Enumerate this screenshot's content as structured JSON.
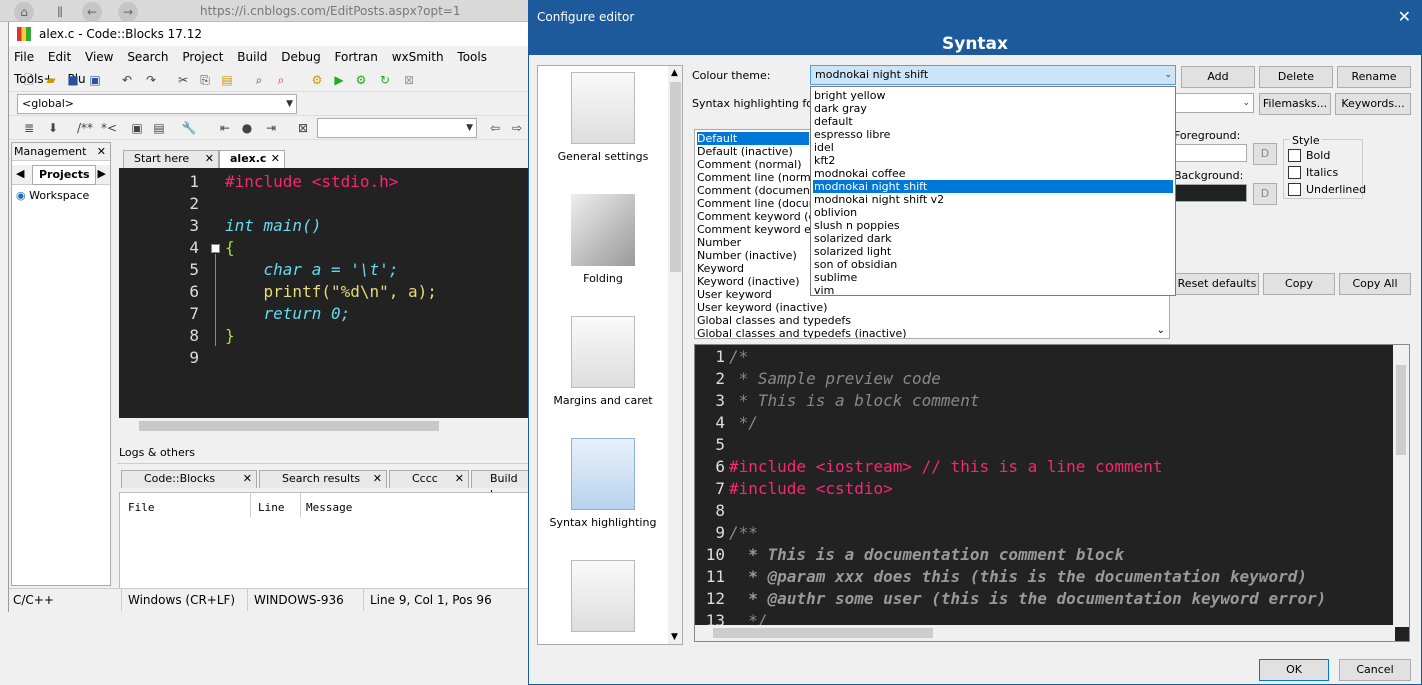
{
  "browser": {
    "url": "https://i.cnblogs.com/EditPosts.aspx?opt=1"
  },
  "cb": {
    "title": "alex.c - Code::Blocks 17.12",
    "menu": [
      "File",
      "Edit",
      "View",
      "Search",
      "Project",
      "Build",
      "Debug",
      "Fortran",
      "wxSmith",
      "Tools",
      "Tools+",
      "Plu"
    ],
    "scope": "<global>",
    "comment_btn": "/**",
    "comment_btn2": "*<",
    "management": "Management",
    "projects_tab": "Projects",
    "workspace": "Workspace",
    "tabs": [
      "Start here",
      "alex.c"
    ],
    "lines": [
      "1",
      "2",
      "3",
      "4",
      "5",
      "6",
      "7",
      "8",
      "9"
    ],
    "code": [
      "#include <stdio.h>",
      "",
      "int main()",
      "{",
      "    char a = '\\t';",
      "    printf(\"%d\\n\", a);",
      "    return 0;",
      "}",
      ""
    ],
    "logs_title": "Logs & others",
    "log_tabs": [
      "Code::Blocks",
      "Search results",
      "Cccc",
      "Build lo"
    ],
    "log_cols": [
      "File",
      "Line",
      "Message"
    ],
    "status": [
      "C/C++",
      "Windows (CR+LF)",
      "WINDOWS-936",
      "Line 9, Col 1, Pos 96"
    ]
  },
  "dialog": {
    "title": "Configure editor",
    "heading": "Syntax",
    "categories": [
      "General settings",
      "Folding",
      "Margins and caret",
      "Syntax highlighting"
    ],
    "colour_theme_label": "Colour theme:",
    "colour_theme_value": "modnokai night shift",
    "syntax_for_label": "Syntax highlighting for:",
    "buttons": {
      "add": "Add",
      "delete": "Delete",
      "rename": "Rename",
      "filemasks": "Filemasks...",
      "keywords": "Keywords...",
      "reset": "Reset defaults",
      "copy": "Copy",
      "copy_all": "Copy All",
      "ok": "OK",
      "cancel": "Cancel",
      "d1": "D",
      "d2": "D"
    },
    "foreground_label": "Foreground:",
    "background_label": "Background:",
    "style_label": "Style",
    "style_opts": [
      "Bold",
      "Italics",
      "Underlined"
    ],
    "themes": [
      "bright yellow",
      "dark gray",
      "default",
      "espresso libre",
      "idel",
      "kft2",
      "modnokai coffee",
      "modnokai night shift",
      "modnokai night shift v2",
      "oblivion",
      "slush n poppies",
      "solarized dark",
      "solarized light",
      "son of obsidian",
      "sublime",
      "vim"
    ],
    "styles": [
      "Default",
      "Default (inactive)",
      "Comment (normal)",
      "Comment line (normal)",
      "Comment (documentation)",
      "Comment line (documentation)",
      "Comment keyword (documentation)",
      "Comment keyword error",
      "Number",
      "Number (inactive)",
      "Keyword",
      "Keyword (inactive)",
      "User keyword",
      "User keyword (inactive)",
      "Global classes and typedefs",
      "Global classes and typedefs (inactive)"
    ],
    "preview_lines": [
      "1",
      "2",
      "3",
      "4",
      "5",
      "6",
      "7",
      "8",
      "9",
      "10",
      "11",
      "12",
      "13"
    ],
    "preview_code": [
      "/*",
      " * Sample preview code",
      " * This is a block comment",
      " */",
      "",
      "#include <iostream> // this is a line comment",
      "#include <cstdio>",
      "",
      "/**",
      "  * This is a documentation comment block",
      "  * @param xxx does this (this is the documentation keyword)",
      "  * @authr some user (this is the documentation keyword error)",
      "  */"
    ]
  },
  "colors": {
    "accent": "#1c5a9c",
    "editor_bg": "#222222",
    "keyword": "#66d9ef",
    "preproc": "#f92672",
    "string": "#e6db74",
    "number": "#ae81ff"
  }
}
